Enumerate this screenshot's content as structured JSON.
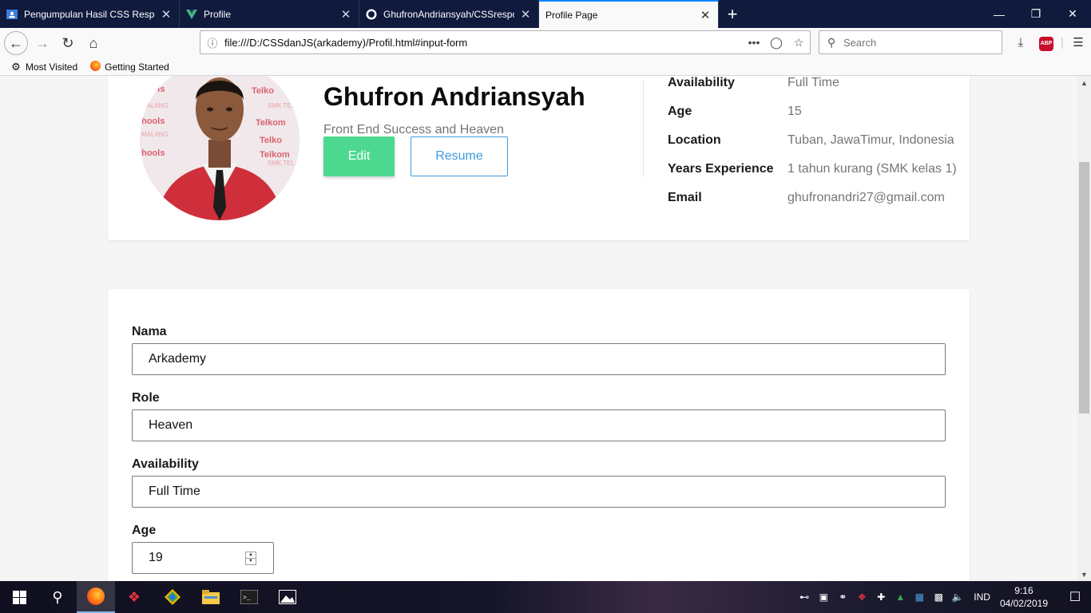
{
  "browser": {
    "tabs": [
      {
        "label": "Pengumpulan Hasil CSS Respon",
        "icon": "classroom-icon",
        "active": false
      },
      {
        "label": "Profile",
        "icon": "vue-icon",
        "active": false
      },
      {
        "label": "GhufronAndriansyah/CSSrespo",
        "icon": "github-icon",
        "active": false
      },
      {
        "label": "Profile Page",
        "icon": "",
        "active": true
      }
    ],
    "url": "file:///D:/CSSdanJS(arkademy)/Profil.html#input-form",
    "search_placeholder": "Search",
    "bookmarks": [
      "Most Visited",
      "Getting Started"
    ],
    "abp_label": "ABP"
  },
  "profile": {
    "name": "Ghufron Andriansyah",
    "role": "Front End Success and Heaven",
    "edit_label": "Edit",
    "resume_label": "Resume",
    "info": [
      {
        "key": "Availability",
        "value": "Full Time"
      },
      {
        "key": "Age",
        "value": "15"
      },
      {
        "key": "Location",
        "value": "Tuban, JawaTimur, Indonesia"
      },
      {
        "key": "Years Experience",
        "value": "1 tahun kurang (SMK kelas 1)"
      },
      {
        "key": "Email",
        "value": "ghufronandri27@gmail.com"
      }
    ]
  },
  "form": {
    "nama": {
      "label": "Nama",
      "value": "Arkademy"
    },
    "role": {
      "label": "Role",
      "value": "Heaven"
    },
    "availability": {
      "label": "Availability",
      "value": "Full Time"
    },
    "age": {
      "label": "Age",
      "value": "19"
    }
  },
  "taskbar": {
    "language": "IND",
    "time": "9:16",
    "date": "04/02/2019"
  },
  "colors": {
    "edit_button": "#4cd98f",
    "resume_button": "#3e9be0",
    "tab_bar": "#0f1a3d",
    "active_tab_accent": "#0a84ff"
  }
}
